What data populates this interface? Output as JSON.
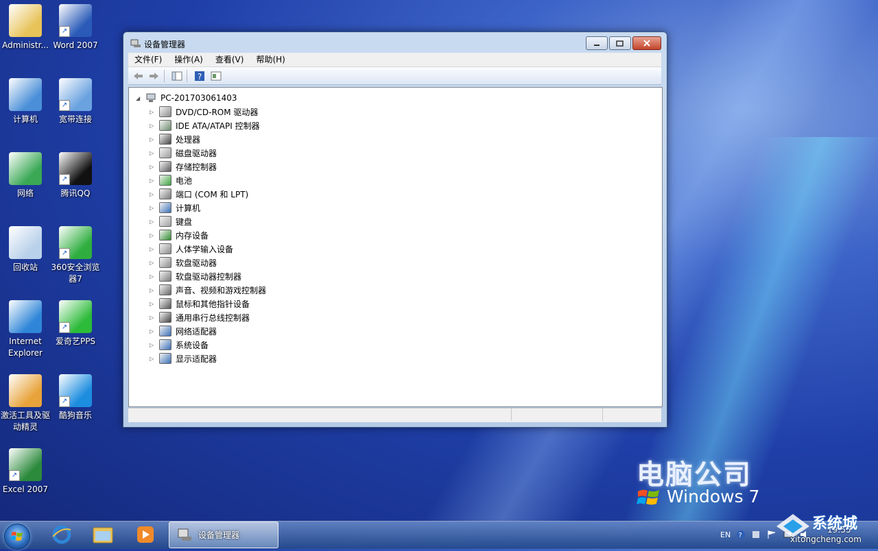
{
  "desktop_icons": [
    {
      "label": "Administr...",
      "icon": "user-folder-icon",
      "color": "#e8c35a"
    },
    {
      "label": "Word 2007",
      "icon": "word-icon",
      "color": "#2a5bb8"
    },
    {
      "label": "计算机",
      "icon": "computer-icon",
      "color": "#4a8fd8"
    },
    {
      "label": "宽带连接",
      "icon": "broadband-icon",
      "color": "#6aa2e0"
    },
    {
      "label": "网络",
      "icon": "network-globe-icon",
      "color": "#3aa855"
    },
    {
      "label": "腾讯QQ",
      "icon": "qq-penguin-icon",
      "color": "#111111"
    },
    {
      "label": "回收站",
      "icon": "recycle-bin-icon",
      "color": "#b9d1ea"
    },
    {
      "label": "360安全浏览器7",
      "icon": "browser-360-icon",
      "color": "#2fae3f"
    },
    {
      "label": "Internet Explorer",
      "icon": "ie-icon",
      "color": "#2f86d8"
    },
    {
      "label": "爱奇艺PPS",
      "icon": "iqiyi-icon",
      "color": "#2dbb3a"
    },
    {
      "label": "激活工具及驱动精灵",
      "icon": "activation-tool-icon",
      "color": "#e8a33a"
    },
    {
      "label": "酷狗音乐",
      "icon": "kugou-icon",
      "color": "#1d8de0"
    },
    {
      "label": "Excel 2007",
      "icon": "excel-icon",
      "color": "#2c8a3c"
    }
  ],
  "window": {
    "title": "设备管理器",
    "menu": [
      "文件(F)",
      "操作(A)",
      "查看(V)",
      "帮助(H)"
    ],
    "tree_root": "PC-201703061403",
    "devices": [
      {
        "label": "DVD/CD-ROM 驱动器",
        "icon": "dvd-drive-icon",
        "color": "#8a8a8a"
      },
      {
        "label": "IDE ATA/ATAPI 控制器",
        "icon": "ide-controller-icon",
        "color": "#6d8b6d"
      },
      {
        "label": "处理器",
        "icon": "processor-icon",
        "color": "#444444"
      },
      {
        "label": "磁盘驱动器",
        "icon": "disk-drive-icon",
        "color": "#9a9a9a"
      },
      {
        "label": "存储控制器",
        "icon": "storage-controller-icon",
        "color": "#5a5a5a"
      },
      {
        "label": "电池",
        "icon": "battery-icon",
        "color": "#3da33d"
      },
      {
        "label": "端口 (COM 和 LPT)",
        "icon": "port-icon",
        "color": "#7a7a7a"
      },
      {
        "label": "计算机",
        "icon": "computer-icon",
        "color": "#3a6fb5"
      },
      {
        "label": "键盘",
        "icon": "keyboard-icon",
        "color": "#a0a0a0"
      },
      {
        "label": "内存设备",
        "icon": "memory-icon",
        "color": "#2e8b2e"
      },
      {
        "label": "人体学输入设备",
        "icon": "hid-icon",
        "color": "#8a8a8a"
      },
      {
        "label": "软盘驱动器",
        "icon": "floppy-drive-icon",
        "color": "#8a8a8a"
      },
      {
        "label": "软盘驱动器控制器",
        "icon": "floppy-controller-icon",
        "color": "#7a7a7a"
      },
      {
        "label": "声音、视频和游戏控制器",
        "icon": "sound-icon",
        "color": "#666666"
      },
      {
        "label": "鼠标和其他指针设备",
        "icon": "mouse-icon",
        "color": "#555555"
      },
      {
        "label": "通用串行总线控制器",
        "icon": "usb-icon",
        "color": "#444444"
      },
      {
        "label": "网络适配器",
        "icon": "network-adapter-icon",
        "color": "#3a6fb5"
      },
      {
        "label": "系统设备",
        "icon": "system-device-icon",
        "color": "#3a6fb5"
      },
      {
        "label": "显示适配器",
        "icon": "display-adapter-icon",
        "color": "#3a6fb5"
      }
    ]
  },
  "taskbar": {
    "active_task": "设备管理器",
    "tray": {
      "lang": "EN",
      "clock": "19:55"
    }
  },
  "brand": {
    "cn": "电脑公司",
    "win": "Windows 7"
  },
  "watermark": {
    "title": "系统城",
    "url": "xitongcheng.com"
  }
}
